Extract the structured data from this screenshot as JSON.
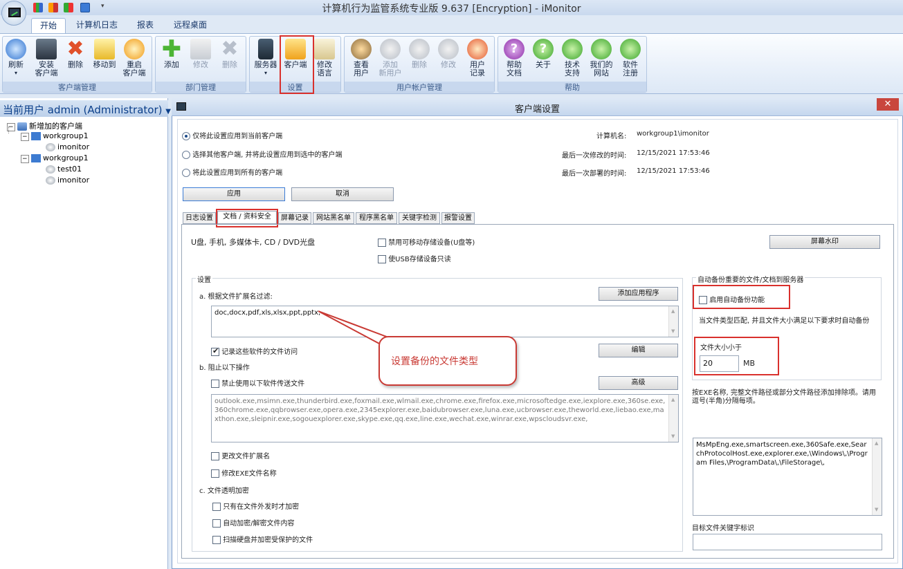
{
  "window": {
    "title": "计算机行为监管系统专业版 9.637 [Encryption] - iMonitor"
  },
  "ribbon": {
    "tabs": [
      "开始",
      "计算机日志",
      "报表",
      "远程桌面"
    ],
    "groups": {
      "client": "客户端管理",
      "dept": "部门管理",
      "settings": "设置",
      "account": "用户帐户管理",
      "help": "帮助"
    },
    "buttons": {
      "refresh": "刷新",
      "install1": "安装",
      "install2": "客户端",
      "delete": "删除",
      "moveto": "移动到",
      "restart1": "重启",
      "restart2": "客户端",
      "add": "添加",
      "modify": "修改",
      "delete2": "删除",
      "server": "服务器",
      "client": "客户端",
      "lang1": "修改",
      "lang2": "语言",
      "viewuser1": "查看",
      "viewuser2": "用户",
      "adduser1": "添加",
      "adduser2": "新用户",
      "deluser": "删除",
      "moduser": "修改",
      "userlog1": "用户",
      "userlog2": "记录",
      "helpdoc1": "帮助",
      "helpdoc2": "文档",
      "about": "关于",
      "support1": "技术",
      "support2": "支持",
      "site1": "我们的",
      "site2": "网站",
      "reg1": "软件",
      "reg2": "注册"
    }
  },
  "left": {
    "current_user": "当前用户 admin (Administrator)",
    "tree": [
      {
        "label": "新增加的客户端",
        "level": 0
      },
      {
        "label": "workgroup1",
        "level": 1
      },
      {
        "label": "imonitor",
        "level": 2
      },
      {
        "label": "workgroup1",
        "level": 1
      },
      {
        "label": "test01",
        "level": 2
      },
      {
        "label": "imonitor",
        "level": 2
      }
    ]
  },
  "dialog": {
    "title": "客户端设置",
    "radio1": "仅将此设置应用到当前客户端",
    "radio2": "选择其他客户端, 并将此设置应用到选中的客户端",
    "radio3": "将此设置应用到所有的客户端",
    "computer_name_label": "计算机名:",
    "computer_name": "workgroup1\\imonitor",
    "last_modified_label": "最后一次修改的时间:",
    "last_modified": "12/15/2021 17:53:46",
    "last_deployed_label": "最后一次部署的时间:",
    "last_deployed": "12/15/2021 17:53:46",
    "apply": "应用",
    "cancel": "取消",
    "tabs": [
      "日志设置",
      "文档 / 资料安全",
      "屏幕记录",
      "网站黑名单",
      "程序黑名单",
      "关键字检测",
      "报警设置"
    ],
    "usb_label": "U盘, 手机, 多媒体卡, CD / DVD光盘",
    "disable_removable": "禁用可移动存储设备(U盘等)",
    "usb_readonly": "使USB存储设备只读",
    "screen_watermark": "屏幕水印",
    "settings_legend": "设置",
    "filter_label": "a. 根据文件扩展名过滤:",
    "add_app": "添加应用程序",
    "extensions": "doc,docx,pdf,xls,xlsx,ppt,pptx,",
    "record_access": "记录这些软件的文件访问",
    "edit": "编辑",
    "block_label": "b. 阻止以下操作",
    "forbid_send": "禁止使用以下软件传送文件",
    "advanced": "高级",
    "programs": "outlook.exe,msimn.exe,thunderbird.exe,foxmail.exe,wlmail.exe,chrome.exe,firefox.exe,microsoftedge.exe,iexplore.exe,360se.exe,360chrome.exe,qqbrowser.exe,opera.exe,2345explorer.exe,baidubrowser.exe,luna.exe,ucbrowser.exe,theworld.exe,liebao.exe,maxthon.exe,sleipnir.exe,sogouexplorer.exe,skype.exe,qq.exe,line.exe,wechat.exe,winrar.exe,wpscloudsvr.exe,",
    "change_ext": "更改文件扩展名",
    "change_exe": "修改EXE文件名称",
    "encrypt_label": "c. 文件透明加密",
    "encrypt_send": "只有在文件外发时才加密",
    "auto_encrypt": "自动加密/解密文件内容",
    "scan_disk": "扫描硬盘并加密受保护的文件",
    "backup_legend": "自动备份重要的文件/文档到服务器",
    "enable_backup": "启用自动备份功能",
    "backup_cond": "当文件类型匹配, 并且文件大小满足以下要求时自动备份",
    "size_label": "文件大小小于",
    "size_value": "20",
    "size_unit": "MB",
    "exclude_desc": "按EXE名称, 完整文件路径或部分文件路径添加排除项。请用逗号(半角)分隔每项。",
    "exclude_list": "MsMpEng.exe,smartscreen.exe,360Safe.exe,SearchProtocolHost.exe,explorer.exe,\\Windows\\,\\Program Files,\\ProgramData\\,\\FileStorage\\,",
    "keyword_label": "目标文件关键字标识",
    "keyword_value": ""
  },
  "annotation": {
    "text": "设置备份的文件类型",
    "color": "#c93a34"
  }
}
